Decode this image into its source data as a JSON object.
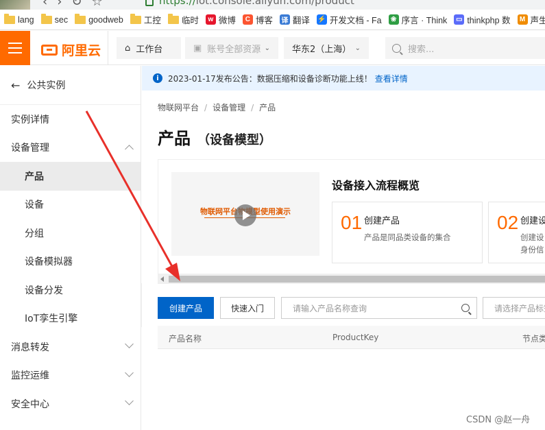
{
  "browser": {
    "url_scheme": "https://",
    "url_rest": "iot.console.aliyun.com/product"
  },
  "bookmarks": [
    {
      "label": "lang",
      "type": "folder"
    },
    {
      "label": "sec",
      "type": "folder"
    },
    {
      "label": "goodweb",
      "type": "folder"
    },
    {
      "label": "工控",
      "type": "folder"
    },
    {
      "label": "临时",
      "type": "folder"
    },
    {
      "label": "微博",
      "type": "weibo-icon"
    },
    {
      "label": "博客",
      "type": "blog-icon"
    },
    {
      "label": "翻译",
      "type": "translate-icon"
    },
    {
      "label": "开发文档 - Fa",
      "type": "bolt-icon"
    },
    {
      "label": "序言 · Think",
      "type": "leaf-icon"
    },
    {
      "label": "thinkphp 数",
      "type": "tv-icon"
    },
    {
      "label": "声生不",
      "type": "m-icon"
    }
  ],
  "topbar": {
    "logo_text": "阿里云",
    "workbench": "工作台",
    "resources": "账号全部资源",
    "region": "华东2（上海）",
    "search_placeholder": "搜索..."
  },
  "sidebar": {
    "back_label": "公共实例",
    "items": [
      {
        "label": "实例详情",
        "level": 0
      },
      {
        "label": "设备管理",
        "level": 0,
        "expanded": true
      },
      {
        "label": "产品",
        "level": 1,
        "active": true
      },
      {
        "label": "设备",
        "level": 1
      },
      {
        "label": "分组",
        "level": 1
      },
      {
        "label": "设备模拟器",
        "level": 1
      },
      {
        "label": "设备分发",
        "level": 1
      },
      {
        "label": "IoT孪生引擎",
        "level": 1
      },
      {
        "label": "消息转发",
        "level": 0,
        "expanded": false
      },
      {
        "label": "监控运维",
        "level": 0,
        "expanded": false
      },
      {
        "label": "安全中心",
        "level": 0,
        "expanded": false
      }
    ]
  },
  "notice": {
    "text": "2023-01-17发布公告：数据压缩和设备诊断功能上线！",
    "link": "查看详情"
  },
  "breadcrumb": [
    "物联网平台",
    "设备管理",
    "产品"
  ],
  "page": {
    "title": "产品",
    "subtitle": "（设备模型）"
  },
  "overview": {
    "video_title": "物联网平台物模型使用演示",
    "title": "设备接入流程概览",
    "steps": [
      {
        "num": "01",
        "title": "创建产品",
        "desc": "产品是同品类设备的集合"
      },
      {
        "num": "02",
        "title": "创建设",
        "desc": "创建设\n身份信"
      }
    ]
  },
  "toolbar": {
    "create_product": "创建产品",
    "quick_entry": "快速入门",
    "search_placeholder": "请输入产品名称查询",
    "select_placeholder": "请选择产品标签"
  },
  "table": {
    "columns": [
      "产品名称",
      "ProductKey",
      "节点类型"
    ]
  },
  "watermark": "CSDN @赵一舟",
  "colors": {
    "brand_orange": "#ff6a00",
    "primary_blue": "#0064c8",
    "annotation_red": "#e8302a"
  }
}
